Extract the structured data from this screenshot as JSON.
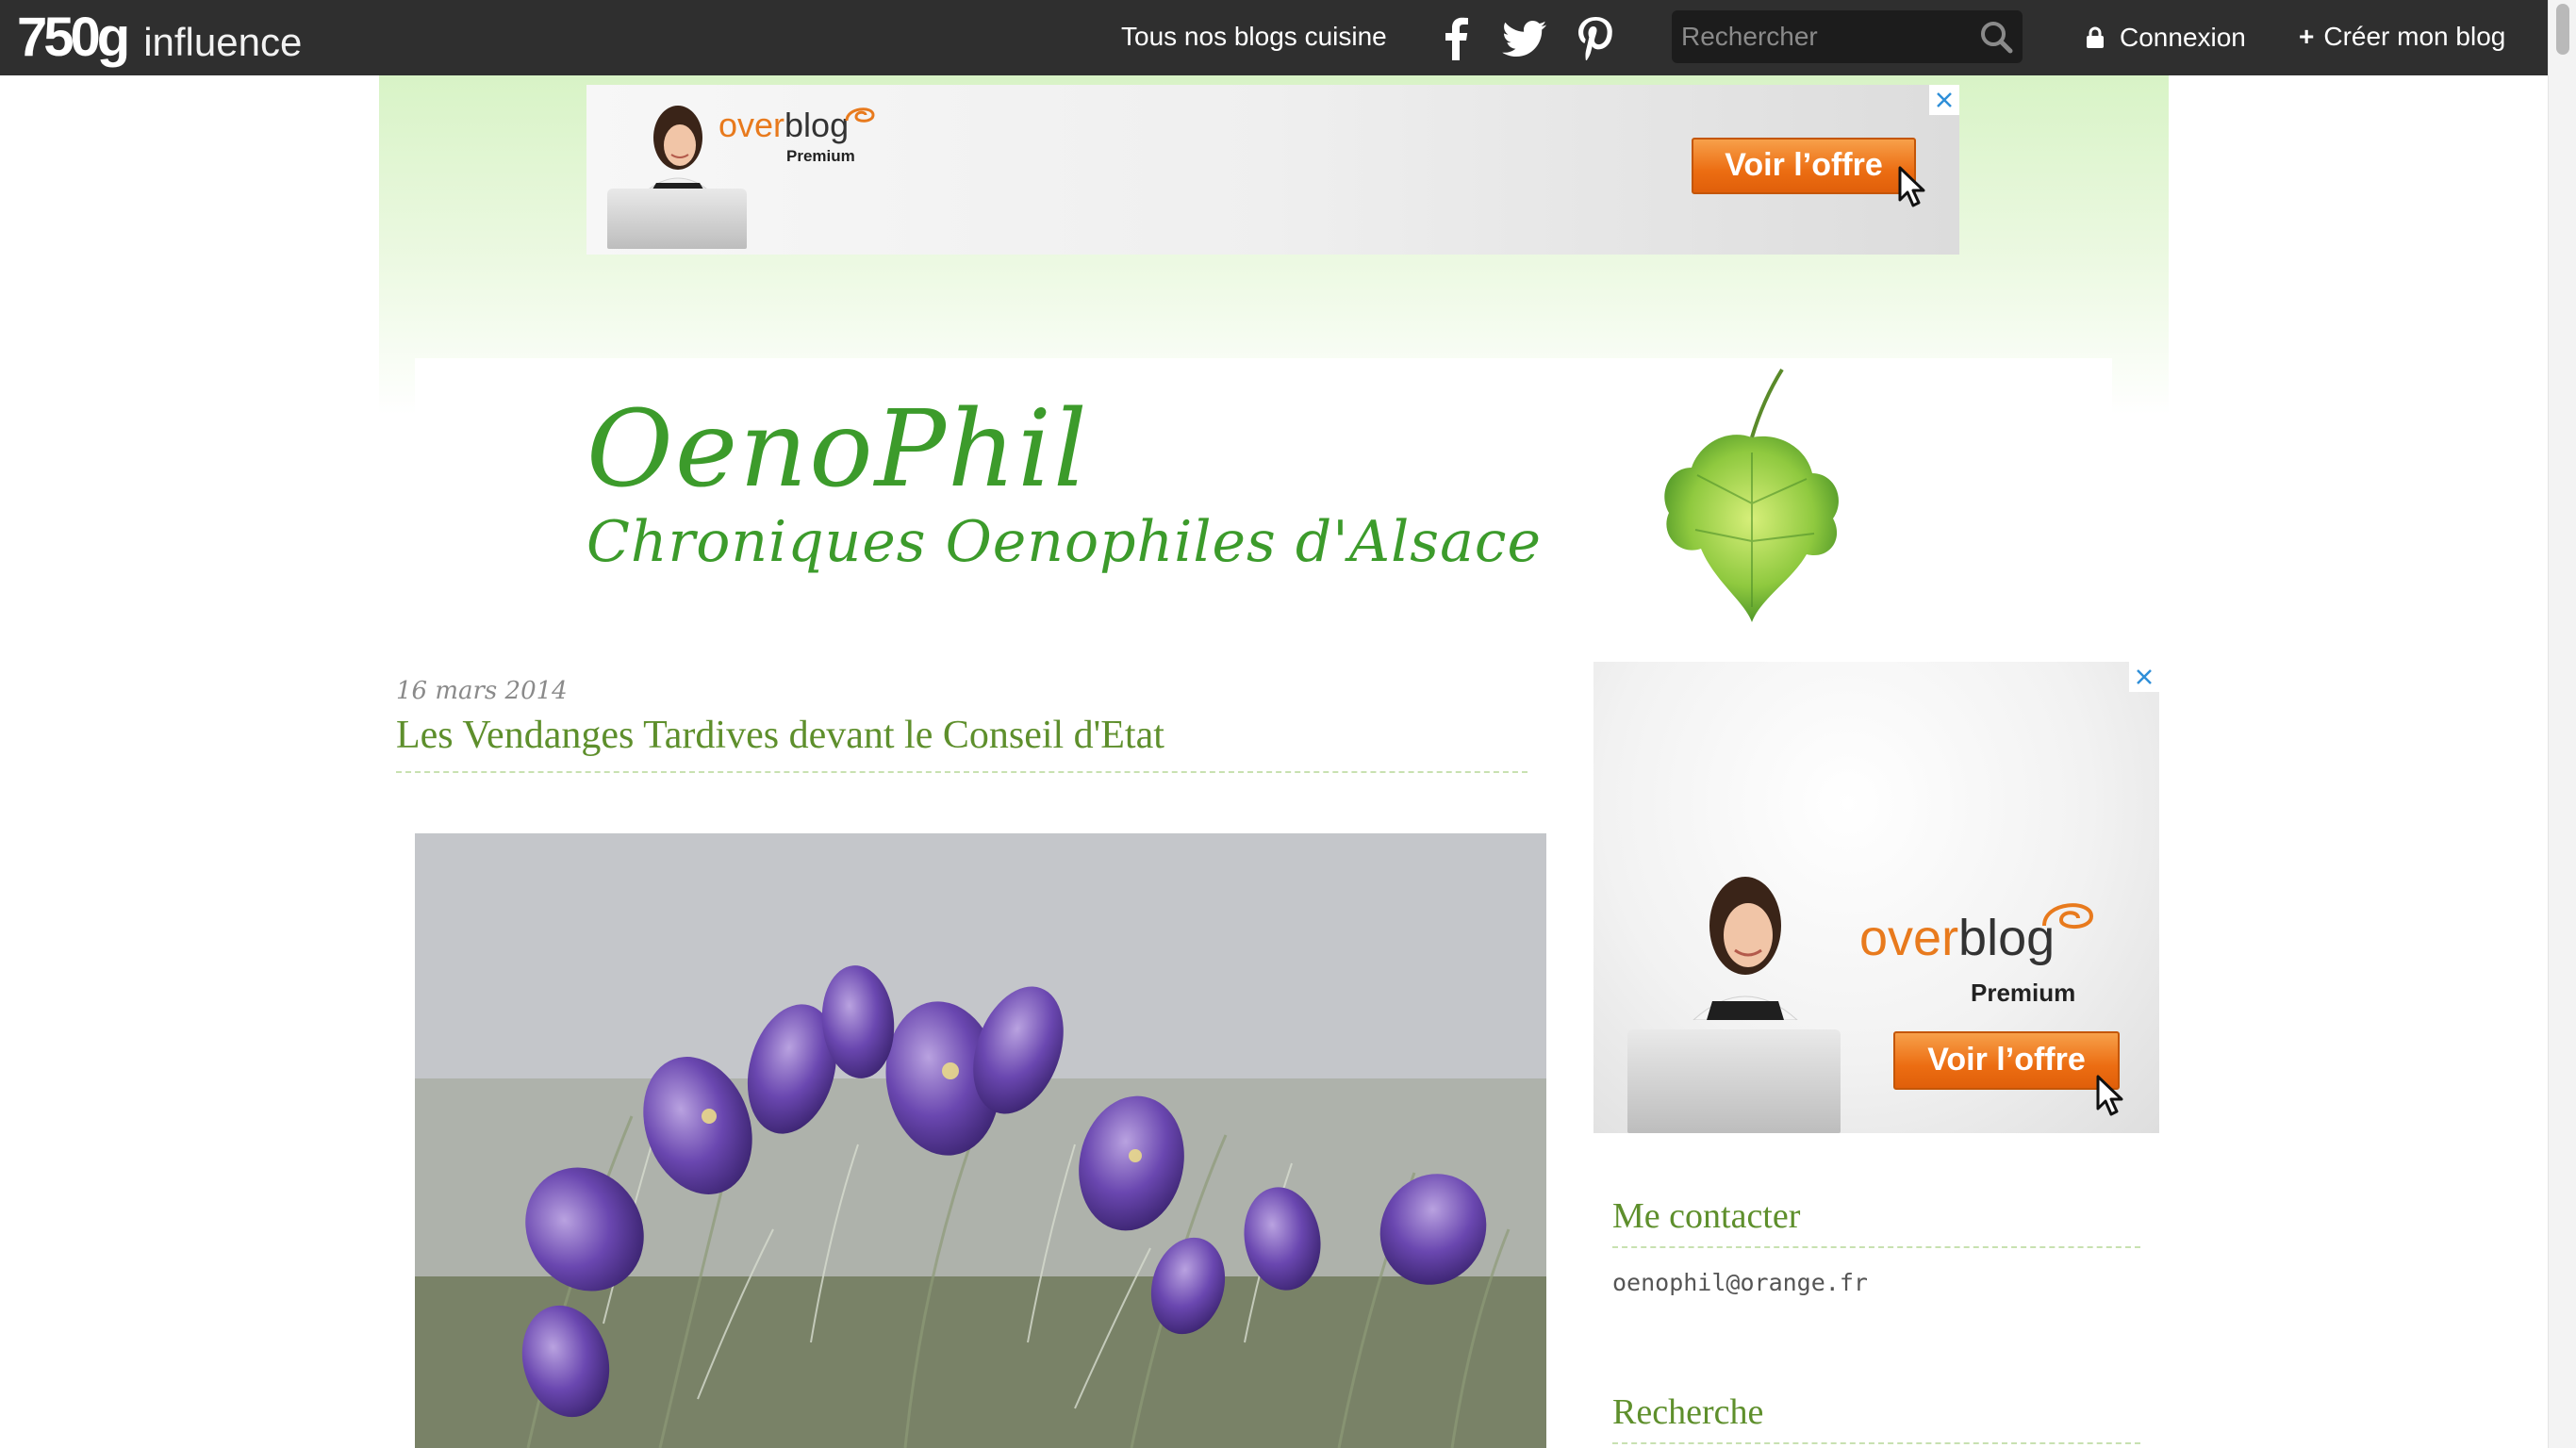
{
  "topbar": {
    "logo_brand": "750g",
    "logo_word": "influence",
    "nav_blogs": "Tous nos blogs cuisine",
    "social_icons": [
      "facebook-icon",
      "twitter-icon",
      "pinterest-icon"
    ],
    "search_placeholder": "Rechercher",
    "login_label": "Connexion",
    "create_plus": "+",
    "create_label": "Créer mon blog"
  },
  "ads": {
    "top": {
      "logo_over": "over",
      "logo_blog": "blog",
      "premium": "Premium",
      "button": "Voir l’offre"
    },
    "side": {
      "logo_over": "over",
      "logo_blog": "blog",
      "premium": "Premium",
      "button": "Voir l’offre"
    }
  },
  "blog_header": {
    "title": "OenoPhil",
    "subtitle": "Chroniques Oenophiles d'Alsace"
  },
  "post": {
    "date": "16 mars 2014",
    "title": "Les Vendanges Tardives devant le Conseil d'Etat"
  },
  "sidebar": {
    "contact": {
      "title": "Me contacter",
      "email": "oenophil@orange.fr"
    },
    "search": {
      "title": "Recherche"
    }
  },
  "colors": {
    "topbar": "#2f2f2f",
    "accent_green": "#5e8f2c",
    "header_green": "#3c9b2b",
    "ad_orange": "#ec6d12"
  }
}
